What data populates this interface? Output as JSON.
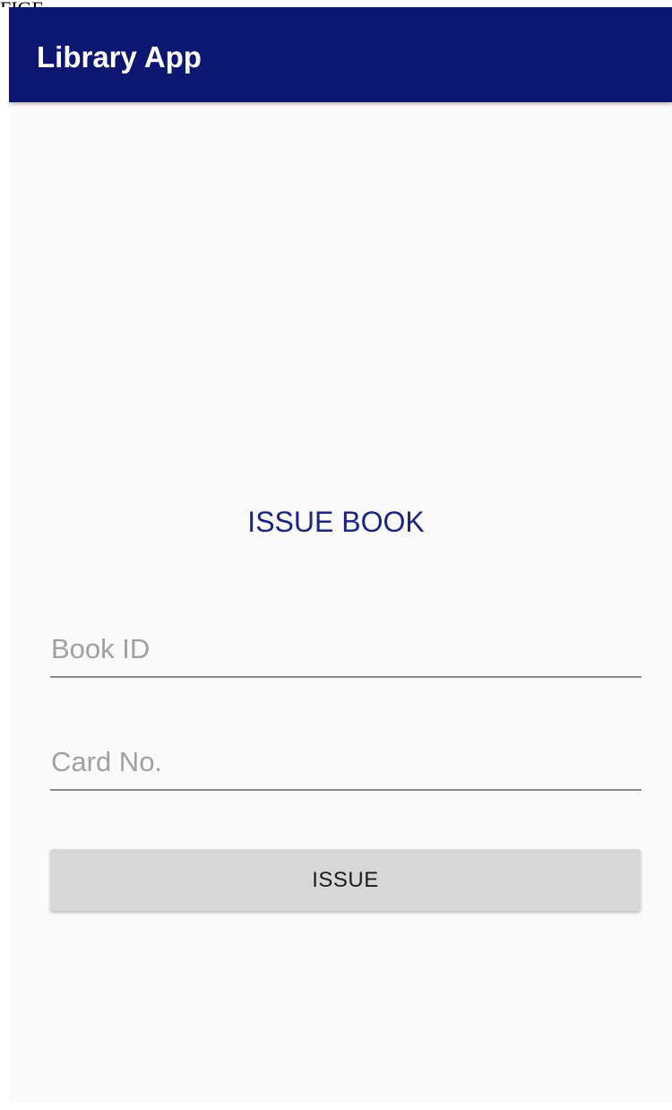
{
  "corner_label": "FIGE",
  "app_bar": {
    "title": "Library App",
    "color": "#0d1770"
  },
  "screen": {
    "heading": "ISSUE BOOK",
    "heading_color": "#1a237e"
  },
  "form": {
    "book_id": {
      "placeholder": "Book ID",
      "value": ""
    },
    "card_no": {
      "placeholder": "Card No.",
      "value": ""
    },
    "issue_button_label": "ISSUE"
  }
}
